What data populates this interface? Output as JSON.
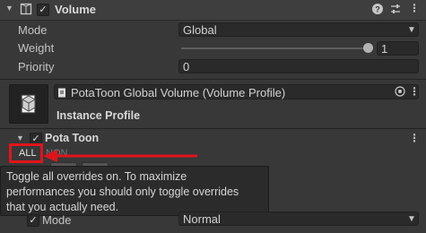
{
  "header": {
    "title": "Volume",
    "enabled_checkbox": "✓",
    "icons": [
      "help-icon",
      "presets-icon",
      "more-icon"
    ]
  },
  "fields": [
    {
      "label": "Mode",
      "value": "Global"
    },
    {
      "label": "Weight",
      "value": "1",
      "slider_fraction": 1.0
    },
    {
      "label": "Priority",
      "value": "0"
    }
  ],
  "profile": {
    "asset_name": "PotaToon Global Volume (Volume Profile)",
    "caption": "Instance Profile"
  },
  "override": {
    "title": "Pota Toon",
    "checkbox": "✓",
    "all_button": "ALL",
    "none_partial": "NON"
  },
  "tooltip": {
    "lines": [
      "Toggle all overrides on. To maximize",
      "performances you should only toggle overrides",
      "that you actually need."
    ]
  },
  "bottom_row": {
    "label": "Mode",
    "value": "Normal",
    "checkbox": "✓"
  },
  "colors": {
    "highlight": "#e0141b",
    "background": "#383838"
  }
}
